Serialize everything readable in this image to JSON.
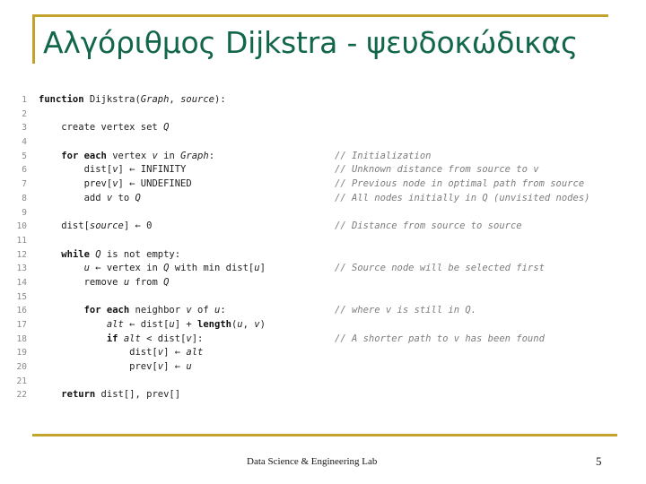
{
  "slide": {
    "title": "Αλγόριθμος Dijkstra - ψευδοκώδικας",
    "accent_color": "#c3a32c",
    "title_color": "#12664a"
  },
  "footer": {
    "text": "Data Science & Engineering Lab",
    "page_number": "5"
  },
  "code": {
    "language": "pseudocode",
    "lines": [
      {
        "no": "1",
        "text": "function Dijkstra(Graph, source):",
        "comment": ""
      },
      {
        "no": "2",
        "text": "",
        "comment": ""
      },
      {
        "no": "3",
        "text": "    create vertex set Q",
        "comment": ""
      },
      {
        "no": "4",
        "text": "",
        "comment": ""
      },
      {
        "no": "5",
        "text": "    for each vertex v in Graph:",
        "comment": "// Initialization"
      },
      {
        "no": "6",
        "text": "        dist[v] ← INFINITY",
        "comment": "// Unknown distance from source to v"
      },
      {
        "no": "7",
        "text": "        prev[v] ← UNDEFINED",
        "comment": "// Previous node in optimal path from source"
      },
      {
        "no": "8",
        "text": "        add v to Q",
        "comment": "// All nodes initially in Q (unvisited nodes)"
      },
      {
        "no": "9",
        "text": "",
        "comment": ""
      },
      {
        "no": "10",
        "text": "    dist[source] ← 0",
        "comment": "// Distance from source to source"
      },
      {
        "no": "11",
        "text": "",
        "comment": ""
      },
      {
        "no": "12",
        "text": "    while Q is not empty:",
        "comment": ""
      },
      {
        "no": "13",
        "text": "        u ← vertex in Q with min dist[u]",
        "comment": "// Source node will be selected first"
      },
      {
        "no": "14",
        "text": "        remove u from Q",
        "comment": ""
      },
      {
        "no": "15",
        "text": "",
        "comment": ""
      },
      {
        "no": "16",
        "text": "        for each neighbor v of u:",
        "comment": "// where v is still in Q."
      },
      {
        "no": "17",
        "text": "            alt ← dist[u] + length(u, v)",
        "comment": ""
      },
      {
        "no": "18",
        "text": "            if alt < dist[v]:",
        "comment": "// A shorter path to v has been found"
      },
      {
        "no": "19",
        "text": "                dist[v] ← alt",
        "comment": ""
      },
      {
        "no": "20",
        "text": "                prev[v] ← u",
        "comment": ""
      },
      {
        "no": "21",
        "text": "",
        "comment": ""
      },
      {
        "no": "22",
        "text": "    return dist[], prev[]",
        "comment": ""
      }
    ]
  }
}
